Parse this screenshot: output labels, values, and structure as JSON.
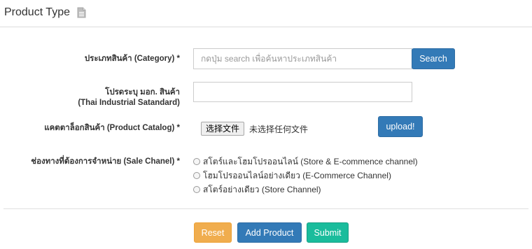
{
  "header": {
    "title": "Product Type",
    "icon": "document-icon"
  },
  "form": {
    "category": {
      "label": "ประเภทสินค้า (Category) *",
      "placeholder": "กดปุ่ม search เพื่อค้นหาประเภทสินค้า",
      "search_label": "Search"
    },
    "tis": {
      "label_line1": "โปรดระบุ มอก. สินค้า",
      "label_line2": "(Thai Industrial Satandard)",
      "value": ""
    },
    "catalog": {
      "label": "แคตตาล็อกสินค้า (Product Catalog) *",
      "choose_file_label": "选择文件",
      "no_file_text": "未选择任何文件",
      "upload_label": "upload!"
    },
    "sale_channel": {
      "label": "ช่องทางที่ต้องการจำหน่าย (Sale Chanel) *",
      "options": [
        "สโตร์และโฮมโปรออนไลน์ (Store & E-commence channel)",
        "โฮมโปรออนไลน์อย่างเดียว (E-Commerce Channel)",
        "สโตร์อย่างเดียว (Store Channel)"
      ]
    }
  },
  "actions": {
    "reset_label": "Reset",
    "add_product_label": "Add Product",
    "submit_label": "Submit"
  },
  "colors": {
    "primary": "#337ab7",
    "warning": "#f0ad4e",
    "success": "#1abc9c"
  }
}
